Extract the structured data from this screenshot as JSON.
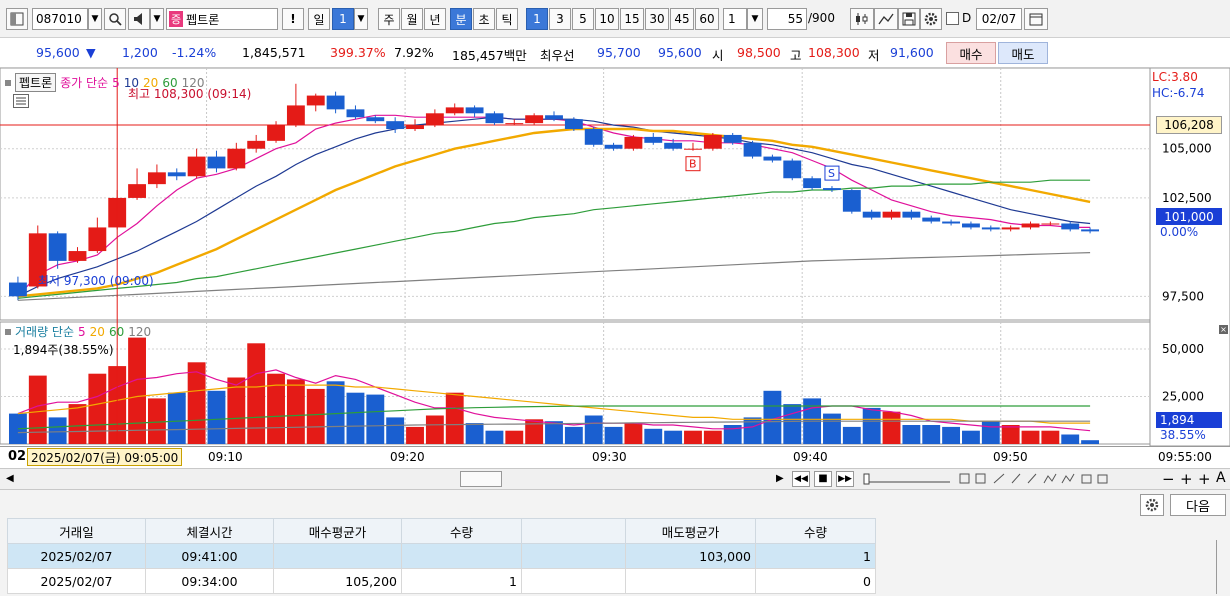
{
  "toolbar": {
    "code": "087010",
    "badge": "증",
    "name": "펩트론",
    "excl": "!",
    "periods": [
      "일",
      "1",
      "주",
      "월",
      "년",
      "분",
      "초",
      "틱"
    ],
    "intervals": [
      "1",
      "3",
      "5",
      "10",
      "15",
      "30",
      "45",
      "60"
    ],
    "multiplier": "1",
    "count": "55",
    "count_max": "/900",
    "d_label": "D",
    "date": "02/07"
  },
  "quote": {
    "price": "95,600",
    "arrow": "▼",
    "change": "1,200",
    "change_pct": "-1.24%",
    "volume": "1,845,571",
    "vol_ratio": "399.37%",
    "turnover": "7.92%",
    "amount": "185,457백만",
    "best_label": "최우선",
    "best_ask": "95,700",
    "best_bid": "95,600",
    "open_label": "시",
    "open": "98,500",
    "high_label": "고",
    "high": "108,300",
    "low_label": "저",
    "low": "91,600",
    "buy_label": "매수",
    "sell_label": "매도"
  },
  "price_panel": {
    "stock_label": "펩트론",
    "ma_label": "종가 단순",
    "ma_periods": [
      "5",
      "10",
      "20",
      "60",
      "120"
    ],
    "high_annot": "최고 108,300 (09:14)",
    "low_annot": "최저 97,300 (09:00)",
    "lc": "LC:3.80",
    "hc": "HC:-6.74",
    "cur_tag": "106,208",
    "last_tag": "101,000",
    "pct_tag": "0.00%",
    "cut_label": "101,000",
    "buy_marker": "B",
    "sell_marker": "S"
  },
  "volume_panel": {
    "label": "거래량 단순",
    "ma_periods": [
      "5",
      "20",
      "60",
      "120"
    ],
    "info": "1,894주(38.55%)",
    "last_tag": "1,894",
    "pct_tag": "38.55%"
  },
  "xaxis": {
    "left_stub": "02",
    "cursor_label": "2025/02/07(금) 09:05:00",
    "ticks": [
      "09:10",
      "09:20",
      "09:30",
      "09:40",
      "09:50"
    ],
    "end_label": "09:55:00"
  },
  "bottom": {
    "next_label": "다음",
    "headers": [
      "거래일",
      "체결시간",
      "매수평균가",
      "수량",
      "",
      "매도평균가",
      "수량"
    ],
    "rows": [
      [
        "2025/02/07",
        "09:41:00",
        "",
        "",
        "",
        "103,000",
        "1"
      ],
      [
        "2025/02/07",
        "09:34:00",
        "105,200",
        "1",
        "",
        "",
        "0"
      ]
    ]
  },
  "chart_data": [
    {
      "type": "candlestick",
      "title": "펩트론",
      "x": [
        "09:00",
        "09:01",
        "09:02",
        "09:03",
        "09:04",
        "09:05",
        "09:06",
        "09:07",
        "09:08",
        "09:09",
        "09:10",
        "09:11",
        "09:12",
        "09:13",
        "09:14",
        "09:15",
        "09:16",
        "09:17",
        "09:18",
        "09:19",
        "09:20",
        "09:21",
        "09:22",
        "09:23",
        "09:24",
        "09:25",
        "09:26",
        "09:27",
        "09:28",
        "09:29",
        "09:30",
        "09:31",
        "09:32",
        "09:33",
        "09:34",
        "09:35",
        "09:36",
        "09:37",
        "09:38",
        "09:39",
        "09:40",
        "09:41",
        "09:42",
        "09:43",
        "09:44",
        "09:45",
        "09:46",
        "09:47",
        "09:48",
        "09:49",
        "09:50",
        "09:51",
        "09:52",
        "09:53",
        "09:54"
      ],
      "open": [
        98200,
        98000,
        100700,
        99300,
        99800,
        101000,
        102500,
        103200,
        103800,
        103600,
        104600,
        104000,
        105000,
        105400,
        106200,
        107200,
        107700,
        107000,
        106600,
        106400,
        106000,
        106200,
        106800,
        107100,
        106800,
        106300,
        106300,
        106700,
        106500,
        106000,
        105200,
        105000,
        105600,
        105300,
        105000,
        105000,
        105700,
        105300,
        104600,
        104400,
        103500,
        103000,
        102900,
        101800,
        101500,
        101800,
        101500,
        101300,
        101200,
        101000,
        100900,
        101000,
        101200,
        101200,
        100900
      ],
      "close": [
        97500,
        100700,
        99300,
        99800,
        101000,
        102500,
        103200,
        103800,
        103600,
        104600,
        104000,
        105000,
        105400,
        106200,
        107200,
        107700,
        107000,
        106600,
        106400,
        106000,
        106200,
        106800,
        107100,
        106800,
        106300,
        106300,
        106700,
        106500,
        106000,
        105200,
        105000,
        105600,
        105300,
        105000,
        105000,
        105700,
        105300,
        104600,
        104400,
        103500,
        103000,
        102900,
        101800,
        101500,
        101800,
        101500,
        101300,
        101200,
        101000,
        100900,
        101000,
        101200,
        101200,
        100900,
        100800
      ],
      "high": [
        98500,
        101100,
        100800,
        100000,
        101500,
        102900,
        104000,
        104200,
        104000,
        105000,
        104900,
        105300,
        105700,
        106400,
        108300,
        107800,
        107900,
        107200,
        106700,
        106600,
        106500,
        107000,
        107300,
        107200,
        106900,
        106500,
        106800,
        106900,
        106600,
        106100,
        105300,
        105700,
        105800,
        105500,
        105300,
        105800,
        105800,
        105400,
        104700,
        104500,
        103600,
        103100,
        102950,
        101900,
        101900,
        101900,
        101600,
        101400,
        101300,
        101100,
        101100,
        101300,
        101300,
        101300,
        101000
      ],
      "low": [
        97300,
        97900,
        98900,
        99200,
        99700,
        100900,
        102400,
        103000,
        103400,
        103500,
        103800,
        103900,
        104800,
        105300,
        106100,
        106900,
        106800,
        106500,
        106300,
        105800,
        105900,
        106100,
        106700,
        106600,
        106200,
        106200,
        106200,
        106400,
        105900,
        105100,
        104900,
        104900,
        105200,
        104900,
        104900,
        104900,
        105200,
        104500,
        104300,
        103400,
        102900,
        102800,
        101700,
        101400,
        101400,
        101400,
        101200,
        101100,
        100900,
        100800,
        100800,
        100900,
        101100,
        100800,
        100700
      ],
      "ma": [
        {
          "name": "5",
          "color": "#e0119b",
          "values": [
            97500,
            98600,
            99100,
            99300,
            99600,
            100500,
            101200,
            102100,
            102900,
            103500,
            103700,
            104000,
            104500,
            105000,
            105300,
            106000,
            106300,
            106500,
            106700,
            106700,
            106600,
            106600,
            106600,
            106600,
            106600,
            106500,
            106500,
            106500,
            106400,
            106100,
            105800,
            105600,
            105500,
            105400,
            105400,
            105300,
            105300,
            105200,
            105000,
            104800,
            104400,
            104000,
            103400,
            102900,
            102400,
            102100,
            101800,
            101600,
            101500,
            101400,
            101200,
            101100,
            101100,
            101000,
            101000
          ]
        },
        {
          "name": "10",
          "color": "#1f3a93",
          "values": [
            97500,
            98000,
            98400,
            98700,
            99000,
            99400,
            99800,
            100300,
            100800,
            101300,
            101900,
            102500,
            103100,
            103600,
            104200,
            104700,
            105100,
            105500,
            105800,
            106000,
            106200,
            106300,
            106400,
            106500,
            106600,
            106500,
            106500,
            106500,
            106500,
            106400,
            106200,
            106100,
            105900,
            105800,
            105700,
            105600,
            105500,
            105300,
            105200,
            105000,
            104800,
            104500,
            104200,
            104000,
            103700,
            103400,
            103100,
            102800,
            102500,
            102200,
            101900,
            101700,
            101500,
            101300,
            101200
          ]
        },
        {
          "name": "20",
          "color": "#f2a900",
          "values": [
            97500,
            97600,
            97700,
            97800,
            97900,
            98100,
            98400,
            98700,
            99100,
            99500,
            99900,
            100400,
            100900,
            101400,
            101900,
            102400,
            102900,
            103300,
            103700,
            104100,
            104400,
            104700,
            105000,
            105200,
            105400,
            105600,
            105800,
            105900,
            106000,
            106000,
            106000,
            106000,
            105900,
            105900,
            105800,
            105700,
            105600,
            105500,
            105400,
            105200,
            105100,
            104900,
            104700,
            104500,
            104300,
            104100,
            103900,
            103700,
            103500,
            103300,
            103100,
            102900,
            102700,
            102500,
            102300
          ]
        },
        {
          "name": "60",
          "color": "#2e9d3a",
          "values": [
            97400,
            97500,
            97600,
            97700,
            97800,
            97900,
            98000,
            98100,
            98200,
            98400,
            98500,
            98700,
            98900,
            99100,
            99300,
            99500,
            99700,
            99900,
            100100,
            100300,
            100500,
            100700,
            100800,
            101000,
            101200,
            101300,
            101500,
            101600,
            101700,
            101900,
            102000,
            102100,
            102200,
            102300,
            102400,
            102500,
            102600,
            102700,
            102800,
            102800,
            102900,
            102900,
            103000,
            103000,
            103100,
            103100,
            103200,
            103200,
            103200,
            103300,
            103300,
            103300,
            103400,
            103400,
            103400
          ]
        },
        {
          "name": "120",
          "color": "#808080",
          "values": [
            97300,
            97350,
            97400,
            97450,
            97500,
            97550,
            97600,
            97650,
            97700,
            97750,
            97800,
            97850,
            97900,
            97950,
            98000,
            98050,
            98100,
            98150,
            98200,
            98250,
            98300,
            98350,
            98400,
            98450,
            98500,
            98550,
            98600,
            98650,
            98700,
            98750,
            98800,
            98850,
            98900,
            98950,
            99000,
            99050,
            99100,
            99150,
            99200,
            99250,
            99300,
            99330,
            99360,
            99390,
            99420,
            99450,
            99480,
            99510,
            99540,
            99570,
            99600,
            99630,
            99660,
            99690,
            99720
          ]
        }
      ],
      "markers": [
        {
          "x": "09:34",
          "label": "B"
        },
        {
          "x": "09:41",
          "label": "S"
        }
      ],
      "ylim": [
        96500,
        109000
      ],
      "yticks": [
        "97,500",
        "102,500",
        "105,000"
      ],
      "hline": 106208
    },
    {
      "type": "bar",
      "title": "거래량",
      "x_ref": "same as price",
      "values": [
        16000,
        36000,
        14000,
        21000,
        37000,
        41000,
        56000,
        24000,
        27000,
        43000,
        28000,
        35000,
        53000,
        37000,
        34000,
        29000,
        33000,
        27000,
        26000,
        14000,
        9000,
        15000,
        27000,
        11000,
        7000,
        7000,
        13000,
        12000,
        9000,
        15000,
        9000,
        11000,
        8000,
        7000,
        7000,
        7000,
        10000,
        14000,
        28000,
        21000,
        24000,
        16000,
        9000,
        19000,
        17000,
        10000,
        10000,
        9000,
        7000,
        12000,
        10000,
        7000,
        7000,
        5000,
        2000
      ],
      "ma": [
        {
          "name": "5",
          "color": "#e0119b",
          "values": [
            16000,
            20000,
            22000,
            22000,
            25000,
            30000,
            34000,
            35000,
            37000,
            38000,
            34000,
            31000,
            37000,
            39000,
            35000,
            32000,
            36000,
            34000,
            30000,
            26000,
            22000,
            19000,
            19000,
            16000,
            14000,
            13000,
            12000,
            11000,
            10000,
            11000,
            11000,
            11000,
            10000,
            10000,
            9000,
            8000,
            8000,
            9000,
            13000,
            16000,
            19000,
            20000,
            20000,
            18000,
            17000,
            15000,
            12000,
            11000,
            10000,
            9000,
            9000,
            9000,
            9000,
            8000,
            7000
          ]
        },
        {
          "name": "20",
          "color": "#f2a900",
          "values": [
            16000,
            17000,
            18000,
            19000,
            21000,
            23000,
            25000,
            26000,
            27000,
            28000,
            29000,
            30000,
            30000,
            31000,
            31000,
            31000,
            31000,
            30000,
            30000,
            29000,
            28000,
            27000,
            26000,
            25000,
            24000,
            23000,
            22000,
            21000,
            20000,
            19000,
            18000,
            17000,
            16000,
            15000,
            14000,
            14000,
            13000,
            13000,
            13000,
            13000,
            13000,
            13000,
            13000,
            13000,
            13000,
            13000,
            13000,
            13000,
            12000,
            12000,
            12000,
            12000,
            11000,
            11000,
            11000
          ]
        },
        {
          "name": "60",
          "color": "#2e9d3a",
          "values": [
            8000,
            8500,
            9000,
            9500,
            10000,
            10500,
            11000,
            11500,
            12000,
            12500,
            13000,
            13500,
            14000,
            14500,
            15000,
            15500,
            16000,
            16500,
            17000,
            17500,
            18000,
            18500,
            18800,
            19100,
            19300,
            19500,
            19700,
            19800,
            19900,
            20000,
            20000,
            20000,
            20000,
            20000,
            20000,
            20000,
            20000,
            20000,
            20000,
            20000,
            20000,
            20000,
            20000,
            20000,
            20000,
            20000,
            20000,
            20000,
            20000,
            20000,
            20000,
            20000,
            20000,
            20000,
            20000
          ]
        },
        {
          "name": "120",
          "color": "#808080",
          "values": [
            6000,
            6200,
            6400,
            6600,
            6800,
            7000,
            7200,
            7400,
            7600,
            7800,
            8000,
            8200,
            8400,
            8600,
            8800,
            9000,
            9200,
            9400,
            9600,
            9800,
            10000,
            10100,
            10200,
            10300,
            10400,
            10500,
            10600,
            10700,
            10800,
            10900,
            11000,
            11100,
            11200,
            11300,
            11400,
            11500,
            11600,
            11700,
            11800,
            11900,
            12000,
            12000,
            12000,
            12000,
            12000,
            12000,
            12000,
            12000,
            12000,
            12000,
            12000,
            12000,
            12000,
            12000,
            12000
          ]
        }
      ],
      "ylim": [
        0,
        60000
      ],
      "yticks": [
        "25,000",
        "50,000"
      ]
    }
  ]
}
